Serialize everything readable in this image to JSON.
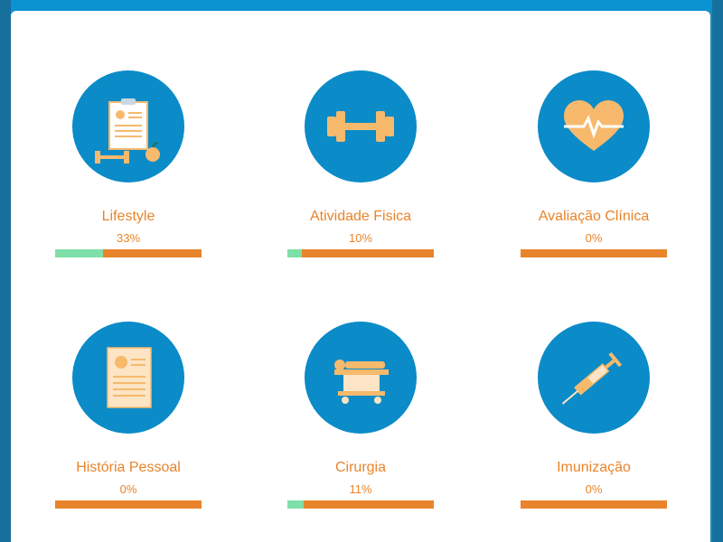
{
  "colors": {
    "primary": "#0b8bc8",
    "accent": "#e8842b",
    "progress": "#7ee0a8",
    "icon": "#f7b96c"
  },
  "categories": [
    {
      "icon": "clipboard-fitness-icon",
      "label": "Lifestyle",
      "percent_text": "33%",
      "progress": 0.33
    },
    {
      "icon": "dumbbell-icon",
      "label": "Atividade Fisica",
      "percent_text": "10%",
      "progress": 0.1
    },
    {
      "icon": "heart-pulse-icon",
      "label": "Avaliação Clínica",
      "percent_text": "0%",
      "progress": 0.0
    },
    {
      "icon": "document-icon",
      "label": "História Pessoal",
      "percent_text": "0%",
      "progress": 0.0
    },
    {
      "icon": "surgery-bed-icon",
      "label": "Cirurgia",
      "percent_text": "11%",
      "progress": 0.11
    },
    {
      "icon": "syringe-icon",
      "label": "Imunização",
      "percent_text": "0%",
      "progress": 0.0
    }
  ]
}
